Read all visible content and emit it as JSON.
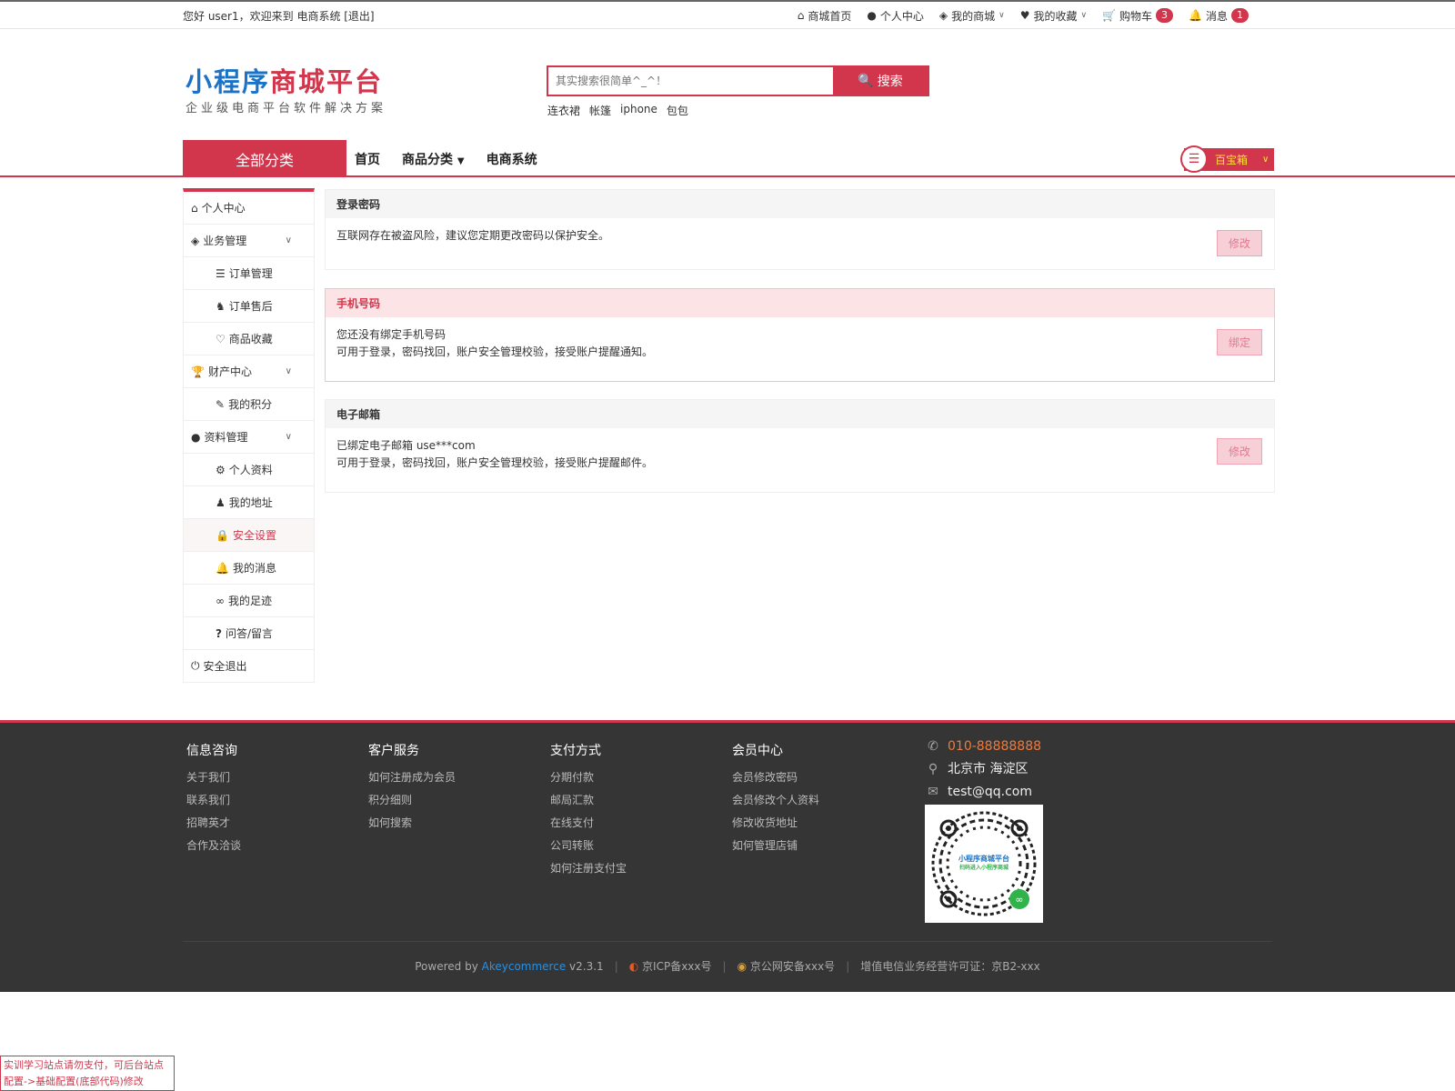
{
  "topbar": {
    "welcome": "您好 user1，欢迎来到 电商系统 [退出]",
    "nav": [
      {
        "icon": "home-icon",
        "glyph": "⌂",
        "label": "商城首页"
      },
      {
        "icon": "user-icon",
        "glyph": "●",
        "label": "个人中心"
      },
      {
        "icon": "cube-icon",
        "glyph": "◈",
        "label": "我的商城"
      },
      {
        "icon": "heart-icon",
        "glyph": "♥",
        "label": "我的收藏"
      },
      {
        "icon": "cart-icon",
        "glyph": "🛒",
        "label": "购物车",
        "badge": "3"
      },
      {
        "icon": "bell-icon",
        "glyph": "🔔",
        "label": "消息",
        "badge": "1"
      }
    ]
  },
  "header": {
    "logo_part1": "小程序",
    "logo_part2": "商城平台",
    "slogan": "企业级电商平台软件解决方案",
    "search_placeholder": "其实搜索很简单^_^！",
    "search_button": "搜索",
    "hotwords": [
      "连衣裙",
      "帐篷",
      "iphone",
      "包包"
    ]
  },
  "navbar": {
    "all_categories": "全部分类",
    "items": [
      "首页",
      "商品分类",
      "电商系统"
    ],
    "treasure": "百宝箱"
  },
  "sidebar": {
    "items": [
      {
        "label": "个人中心",
        "glyph": "⌂",
        "level": 1
      },
      {
        "label": "业务管理",
        "glyph": "◈",
        "level": 1,
        "expandable": true
      },
      {
        "label": "订单管理",
        "glyph": "☰",
        "level": 2
      },
      {
        "label": "订单售后",
        "glyph": "♞",
        "level": 2
      },
      {
        "label": "商品收藏",
        "glyph": "♡",
        "level": 2
      },
      {
        "label": "财产中心",
        "glyph": "🏆",
        "level": 1,
        "expandable": true
      },
      {
        "label": "我的积分",
        "glyph": "✎",
        "level": 2
      },
      {
        "label": "资料管理",
        "glyph": "●",
        "level": 1,
        "expandable": true
      },
      {
        "label": "个人资料",
        "glyph": "⚙",
        "level": 2
      },
      {
        "label": "我的地址",
        "glyph": "♟",
        "level": 2
      },
      {
        "label": "安全设置",
        "glyph": "🔒",
        "level": 2,
        "active": true
      },
      {
        "label": "我的消息",
        "glyph": "🔔",
        "level": 2
      },
      {
        "label": "我的足迹",
        "glyph": "∞",
        "level": 2
      },
      {
        "label": "问答/留言",
        "glyph": "?",
        "level": 2
      },
      {
        "label": "安全退出",
        "glyph": "⏻",
        "level": 1
      }
    ]
  },
  "security": {
    "password": {
      "title": "登录密码",
      "desc1": "互联网存在被盗风险，建议您定期更改密码以保护安全。",
      "button": "修改"
    },
    "phone": {
      "title": "手机号码",
      "desc1": "您还没有绑定手机号码",
      "desc2": "可用于登录，密码找回，账户安全管理校验，接受账户提醒通知。",
      "button": "绑定"
    },
    "email": {
      "title": "电子邮箱",
      "desc1": "已绑定电子邮箱 use***com",
      "desc2": "可用于登录，密码找回，账户安全管理校验，接受账户提醒邮件。",
      "button": "修改"
    }
  },
  "footer": {
    "columns": [
      {
        "title": "信息咨询",
        "links": [
          "关于我们",
          "联系我们",
          "招聘英才",
          "合作及洽谈"
        ]
      },
      {
        "title": "客户服务",
        "links": [
          "如何注册成为会员",
          "积分细则",
          "如何搜索"
        ]
      },
      {
        "title": "支付方式",
        "links": [
          "分期付款",
          "邮局汇款",
          "在线支付",
          "公司转账",
          "如何注册支付宝"
        ]
      },
      {
        "title": "会员中心",
        "links": [
          "会员修改密码",
          "会员修改个人资料",
          "修改收货地址",
          "如何管理店铺"
        ]
      }
    ],
    "phone": "010-88888888",
    "address": "北京市 海淀区",
    "email": "test@qq.com",
    "qr_text1": "小程序商城平台",
    "qr_text2": "扫码进入小程序商城",
    "powered_prefix": "Powered by",
    "powered_brand": "Akeycommerce",
    "version": "v2.3.1",
    "icp": "京ICP备xxx号",
    "police": "京公网安备xxx号",
    "license": "增值电信业务经营许可证：京B2-xxx"
  },
  "notice": "实训学习站点请勿支付，可后台站点配置->基础配置(底部代码)修改",
  "colors": {
    "accent": "#d2364c",
    "logo_blue": "#1a73c8",
    "footer_bg": "#353535"
  }
}
